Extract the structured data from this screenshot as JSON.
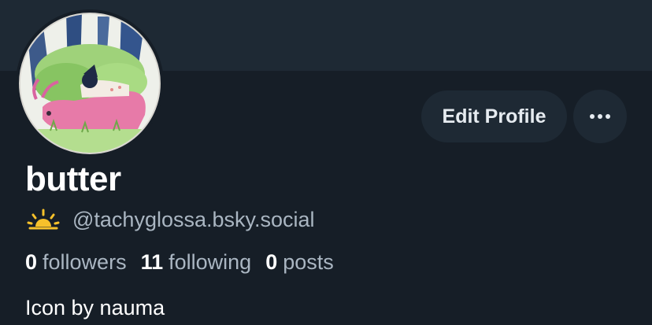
{
  "profile": {
    "display_name": "butter",
    "handle": "@tachyglossa.bsky.social",
    "handle_badge_icon": "sunrise-icon",
    "bio": "Icon by nauma",
    "stats": {
      "followers_count": "0",
      "followers_label": "followers",
      "following_count": "11",
      "following_label": "following",
      "posts_count": "0",
      "posts_label": "posts"
    }
  },
  "actions": {
    "edit_profile_label": "Edit Profile",
    "more_icon": "ellipsis-icon"
  },
  "colors": {
    "background": "#161e27",
    "banner": "#1e2934",
    "button_bg": "#1e2934",
    "text_primary": "#ffffff",
    "text_secondary": "#aab6c2",
    "sun_badge": "#f6c12b"
  }
}
